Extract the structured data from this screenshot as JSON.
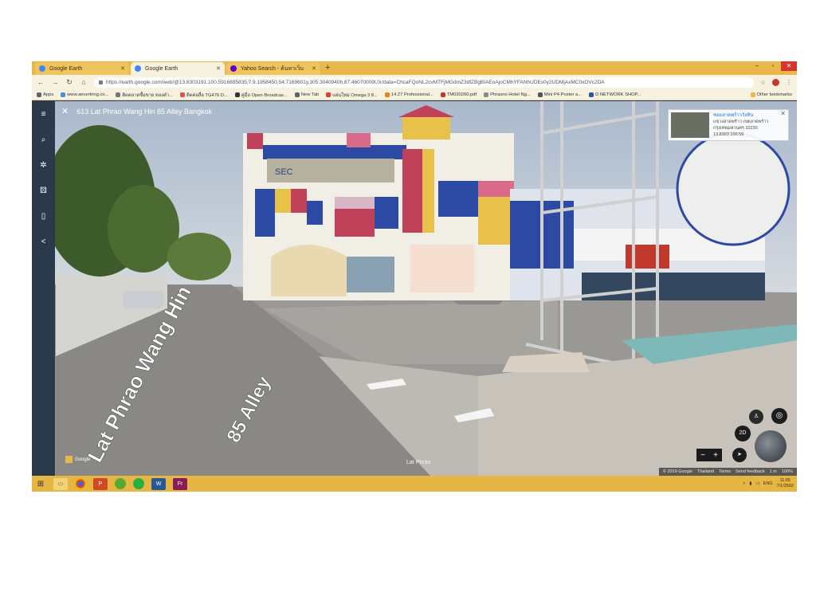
{
  "browser": {
    "tabs": [
      {
        "label": "Google Earth",
        "favicon_color": "#4285f4",
        "active": false
      },
      {
        "label": "Google Earth",
        "favicon_color": "#4285f4",
        "active": true
      },
      {
        "label": "Yahoo Search - ค้นหาเว็บ",
        "favicon_color": "#6001d2",
        "active": false
      }
    ],
    "new_tab": "+",
    "window_controls": {
      "minimize": "–",
      "maximize": "▫",
      "close": "✕"
    },
    "url": "https://earth.google.com/web/@13.8303191,100.5916885835,7,9.1958450,54.7169601y,305.3040940h,87.46070009t,0r/data=ChcaFQoNL2cvMTFjMGdmZ3dfZBgBIAEoAjoCMhYFANhUDEs0y2UDMjAxMC0xOVc2DA",
    "bookmarks": [
      {
        "label": "Apps",
        "color": "#5f6368"
      },
      {
        "label": "www.aecertring.co...",
        "color": "#4a90d9"
      },
      {
        "label": "ติดตลาดซื้อขาย ทองคำ...",
        "color": "#777777"
      },
      {
        "label": "ติดต่อสื่อ TG476 D...",
        "color": "#d9534f"
      },
      {
        "label": "คู่มือ Open Broadcas...",
        "color": "#333333"
      },
      {
        "label": "New Tab",
        "color": "#5f6368"
      },
      {
        "label": "แผ่นใหม่ Omega 3 8...",
        "color": "#e03d2f"
      },
      {
        "label": "14.27 Professional...",
        "color": "#e67e22"
      },
      {
        "label": "TM020260.pdf",
        "color": "#c0392b"
      },
      {
        "label": "Phrasno Hotel Ng...",
        "color": "#888888"
      },
      {
        "label": "Mini P4 Poster a...",
        "color": "#555555"
      },
      {
        "label": "D NETWORK SHOP...",
        "color": "#2b5797"
      }
    ],
    "other_bookmarks": "Other bookmarks"
  },
  "streetview": {
    "location_title": "613 Lat Phrao Wang Hin 85 Alley Bangkok",
    "road_text_1": "Lat Phrao Wang Hin",
    "road_text_2": "85 Alley",
    "info_card": {
      "title": "ซอยลาดพร้าววังหิน",
      "line1": "แขวงลาดพร้าว เขตลาดพร้าว",
      "line2": "กรุงเทพมหานคร 10230",
      "line3": "13.8303 100.59"
    },
    "logo": "Google",
    "street_watermark": "Lat Phrao",
    "controls": {
      "two_d": "2D",
      "zoom_out": "−",
      "zoom_in": "+"
    },
    "attribution": [
      "© 2019 Google",
      "Thailand",
      "Terms",
      "Send feedback",
      "1 m",
      "100%"
    ],
    "building_sign": "SEC"
  },
  "taskbar": {
    "apps": [
      {
        "name": "File Explorer",
        "glyph": "▭"
      },
      {
        "name": "Google Chrome",
        "glyph": ""
      },
      {
        "name": "PowerPoint",
        "glyph": "P"
      },
      {
        "name": "LINE",
        "glyph": ""
      },
      {
        "name": "LINE",
        "glyph": ""
      },
      {
        "name": "Word",
        "glyph": "W"
      },
      {
        "name": "Fireworks",
        "glyph": "Fr"
      }
    ],
    "tray": [
      "ENG"
    ],
    "clock_time": "11:05",
    "clock_date": "7/1/2562"
  },
  "colors": {
    "taskbar": "#e6b645",
    "tabstrip": "#e8b84a",
    "close": "#d9342b"
  }
}
